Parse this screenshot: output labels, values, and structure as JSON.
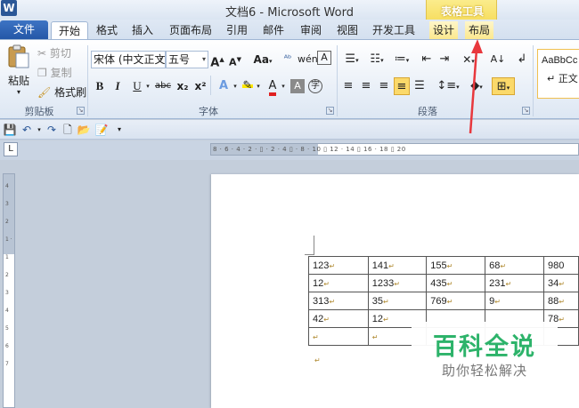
{
  "window": {
    "title": "文档6 - Microsoft Word",
    "app_icon": "W",
    "context_group": "表格工具"
  },
  "tabs": [
    {
      "label": "文件"
    },
    {
      "label": "开始"
    },
    {
      "label": "格式"
    },
    {
      "label": "插入"
    },
    {
      "label": "页面布局"
    },
    {
      "label": "引用"
    },
    {
      "label": "邮件"
    },
    {
      "label": "审阅"
    },
    {
      "label": "视图"
    },
    {
      "label": "开发工具"
    },
    {
      "label": "设计"
    },
    {
      "label": "布局"
    }
  ],
  "ribbon": {
    "clipboard": {
      "label": "剪贴板",
      "paste": "粘贴",
      "cut": "剪切",
      "copy": "复制",
      "format_painter": "格式刷"
    },
    "font": {
      "label": "字体",
      "font_name": "宋体 (中文正文",
      "font_size": "五号",
      "grow": "A",
      "shrink": "A",
      "change_case": "Aa",
      "bold": "B",
      "italic": "I",
      "underline": "U",
      "strike": "abc",
      "subscript": "x₂",
      "superscript": "x²"
    },
    "paragraph": {
      "label": "段落"
    },
    "styles": {
      "preview": "AaBbCc",
      "name": "↵ 正文"
    }
  },
  "table": {
    "rows": [
      [
        "123",
        "141",
        "155",
        "68",
        "980"
      ],
      [
        "12",
        "1233",
        "435",
        "231",
        "34"
      ],
      [
        "313",
        "35",
        "769",
        "9",
        "88"
      ],
      [
        "42",
        "12",
        "",
        "",
        "78"
      ],
      [
        "",
        "",
        "",
        "",
        ""
      ]
    ]
  },
  "watermark": {
    "title": "百科全说",
    "subtitle": "助你轻松解决"
  },
  "colors": {
    "accent_arrow": "#e8383d",
    "watermark_green": "#2db36a"
  }
}
